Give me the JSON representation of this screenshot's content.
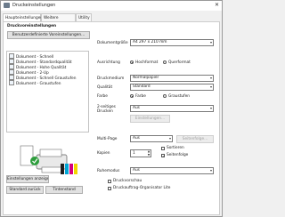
{
  "window": {
    "title": "Druckeinstellungen",
    "close_glyph": "✕"
  },
  "tabs": [
    {
      "label": "Haupteinstellungen",
      "active": true
    },
    {
      "label": "Weitere Optionen",
      "active": false
    },
    {
      "label": "Utility",
      "active": false
    }
  ],
  "presets": {
    "heading": "Druckvoreinstellungen",
    "add_button": "Benutzerdefinierte Voreinstellungen...",
    "items": [
      "Dokument - Schnell",
      "Dokument - Standardqualität",
      "Dokument - Hohe Qualität",
      "Dokument - 2-Up",
      "Dokument - Schnell Graustufen",
      "Dokument - Graustufen"
    ]
  },
  "buttons": {
    "show_settings": "Einstellungen anzeigen",
    "default_settings": "Standard zurück",
    "ink_levels": "Tintenstand"
  },
  "settings": {
    "doc_size_label": "Dokumentgröße",
    "doc_size_value": "A4 297 x 210 mm",
    "orientation_label": "Ausrichtung",
    "orientation_portrait": "Hochformat",
    "orientation_landscape": "Querformat",
    "media_label": "Druckmedium",
    "media_value": "Normalpapier",
    "quality_label": "Qualität",
    "quality_value": "Standard",
    "color_label": "Farbe",
    "color_color": "Farbe",
    "color_gray": "Graustufen",
    "duplex_label": "2-seitiges Drucken",
    "duplex_value": "Aus",
    "duplex_settings": "Einstellungen...",
    "multipage_label": "Multi-Page",
    "multipage_value": "Aus",
    "page_order": "Seitenfolge...",
    "copies_label": "Kopien",
    "copies_value": "1",
    "collate_label": "Sortieren",
    "reverse_label": "Seitenfolge",
    "quiet_label": "Ruhemodus",
    "quiet_value": "Aus",
    "preview_label": "Druckvorschau",
    "organizer_label": "Druckauftrag-Organisator Lite"
  }
}
